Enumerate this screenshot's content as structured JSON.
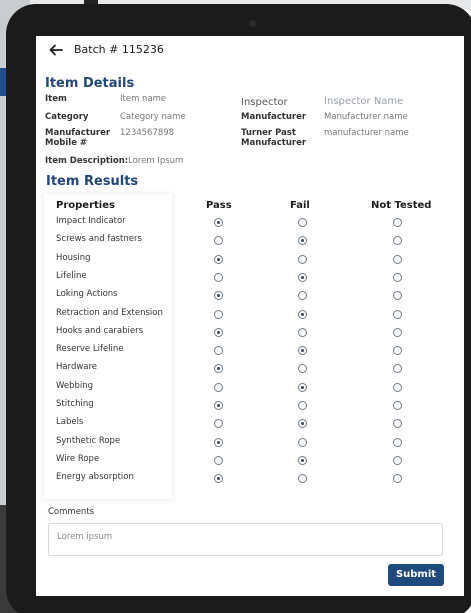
{
  "header": {
    "title": "Batch # 115236"
  },
  "item_details": {
    "title": "Item Details",
    "item_label": "Item",
    "item_value": "Item name",
    "inspector_label": "Inspector",
    "inspector_value": "Inspector Name",
    "category_label": "Category",
    "category_value": "Category name",
    "manufacturer_label": "Manufacturer",
    "manufacturer_value": "Manufacturer name",
    "mobile_label_1": "Manufacturer",
    "mobile_label_2": "Mobile #",
    "mobile_value": "1234567898",
    "turner_label_1": "Turner Past",
    "turner_label_2": "Manufacturer",
    "turner_value": "manufacturer name",
    "description_label": "Item Description:",
    "description_value": "Lorem Ipsum"
  },
  "item_results": {
    "title": "Item Results",
    "columns": [
      "Properties",
      "Pass",
      "Fail",
      "Not Tested"
    ],
    "rows": [
      {
        "label": "Impact Indicator",
        "selected": "pass"
      },
      {
        "label": "Screws and fastners",
        "selected": "fail"
      },
      {
        "label": "Housing",
        "selected": "pass"
      },
      {
        "label": "Lifeline",
        "selected": "fail"
      },
      {
        "label": "Loking Actions",
        "selected": "pass"
      },
      {
        "label": "Retraction and Extension",
        "selected": "fail"
      },
      {
        "label": "Hooks and carabiers",
        "selected": "pass"
      },
      {
        "label": "Reserve Lifeline",
        "selected": "fail"
      },
      {
        "label": "Hardware",
        "selected": "pass"
      },
      {
        "label": "Webbing",
        "selected": "fail"
      },
      {
        "label": "Stitching",
        "selected": "pass"
      },
      {
        "label": "Labels",
        "selected": "fail"
      },
      {
        "label": "Synthetic Rope",
        "selected": "pass"
      },
      {
        "label": "Wire Rope",
        "selected": "fail"
      },
      {
        "label": "Energy absorption",
        "selected": "pass"
      }
    ]
  },
  "comments": {
    "label": "Comments",
    "value": "Lorem ipsum"
  },
  "submit_label": "Submit",
  "colors": {
    "accent": "#1f4a7e",
    "heading": "#22477a"
  }
}
